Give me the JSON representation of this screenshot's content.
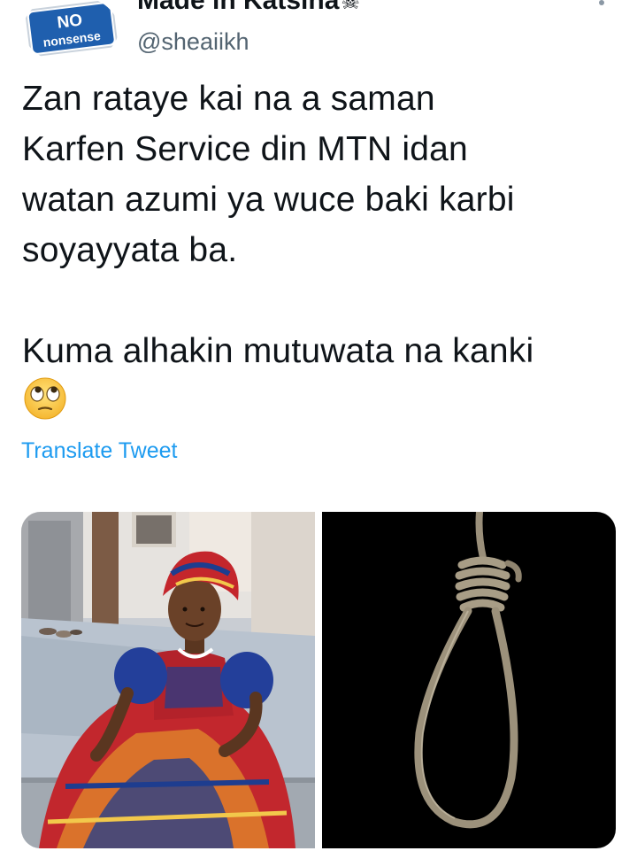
{
  "header": {
    "display_name": "Made in Katsina",
    "name_emoji": "☠",
    "handle": "@sheaiikh",
    "avatar": {
      "icon": "no-nonsense-sign-icon",
      "line1": "NO",
      "line2": "nonsense"
    },
    "more_icon": "more-vertical-icon"
  },
  "tweet": {
    "text": "Zan rataye kai na a saman\nKarfen Service din MTN idan\nwatan azumi ya wuce baki karbi\nsoyayyata ba.\n\nKuma alhakin mutuwata na kanki",
    "emoji": "face-with-rolling-eyes-icon",
    "translate_label": "Translate Tweet"
  },
  "media": [
    {
      "name": "photo-woman-in-ankara-dress",
      "description_icon": "woman-photo-icon"
    },
    {
      "name": "photo-noose",
      "description_icon": "noose-icon"
    }
  ],
  "colors": {
    "text": "#0f1419",
    "secondary": "#536471",
    "link": "#1d9bf0",
    "avatar_blue": "#1f5fae"
  }
}
